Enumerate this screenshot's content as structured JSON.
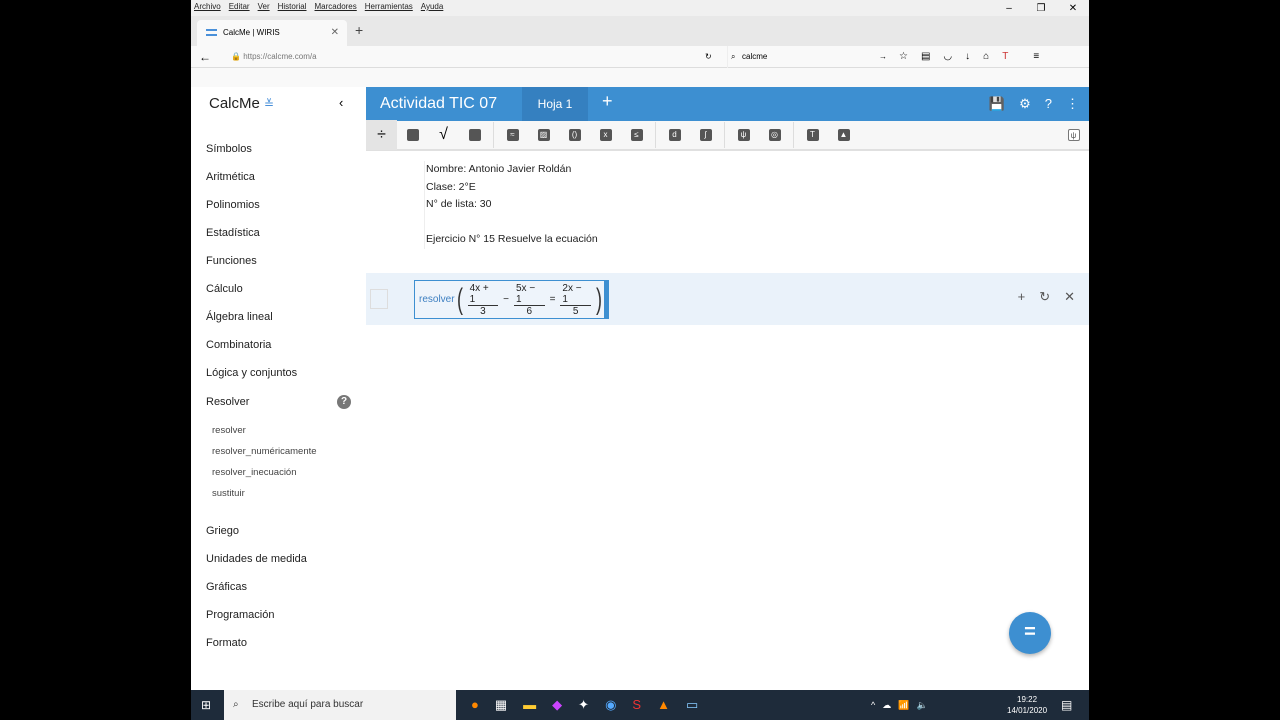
{
  "browser": {
    "menu": [
      "Archivo",
      "Editar",
      "Ver",
      "Historial",
      "Marcadores",
      "Herramientas",
      "Ayuda"
    ],
    "tab_title": "CalcMe | WIRIS",
    "url": "https://calcme.com/a",
    "search_value": "calcme"
  },
  "app": {
    "logo": "CalcMe",
    "title": "Actividad TIC 07",
    "sheet": "Hoja 1",
    "sidebar": [
      "Símbolos",
      "Aritmética",
      "Polinomios",
      "Estadística",
      "Funciones",
      "Cálculo",
      "Álgebra lineal",
      "Combinatoria",
      "Lógica y conjuntos",
      "Resolver"
    ],
    "resolver_sub": [
      "resolver",
      "resolver_numéricamente",
      "resolver_inecuación",
      "sustituir"
    ],
    "sidebar_more": [
      "Griego",
      "Unidades de medida",
      "Gráficas",
      "Programación",
      "Formato"
    ]
  },
  "content": {
    "lines": [
      "Nombre: Antonio Javier Roldán",
      "Clase: 2°E",
      "N° de lista: 30",
      "",
      "Ejercicio N° 15 Resuelve la ecuación"
    ],
    "math": {
      "fn": "resolver",
      "f1n": "4x + 1",
      "f1d": "3",
      "op1": "−",
      "f2n": "5x − 1",
      "f2d": "6",
      "eq": "=",
      "f3n": "2x − 1",
      "f3d": "5"
    }
  },
  "fab": "=",
  "taskbar": {
    "search_placeholder": "Escribe aquí para buscar",
    "time": "19:22",
    "date": "14/01/2020"
  },
  "colors": {
    "accent": "#3d8fd1"
  }
}
